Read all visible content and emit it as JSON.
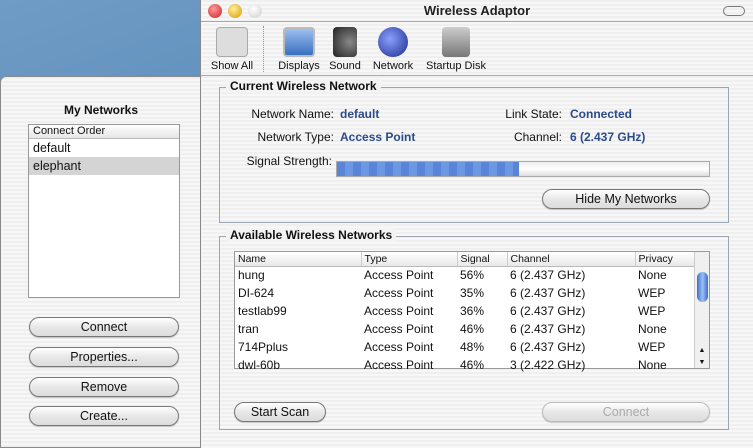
{
  "window": {
    "title": "Wireless Adaptor"
  },
  "toolbar": {
    "items": [
      {
        "label": "Show All",
        "icon": "show-all-icon"
      },
      {
        "label": "Displays",
        "icon": "displays-icon"
      },
      {
        "label": "Sound",
        "icon": "sound-icon"
      },
      {
        "label": "Network",
        "icon": "network-icon"
      },
      {
        "label": "Startup Disk",
        "icon": "startup-disk-icon"
      }
    ]
  },
  "drawer": {
    "title": "My Networks",
    "column": "Connect Order",
    "items": [
      "default",
      "elephant"
    ],
    "selected": 1,
    "buttons": {
      "connect": "Connect",
      "properties": "Properties...",
      "remove": "Remove",
      "create": "Create..."
    }
  },
  "current": {
    "legend": "Current Wireless Network",
    "name_label": "Network Name:",
    "name": "default",
    "type_label": "Network Type:",
    "type": "Access Point",
    "link_label": "Link State:",
    "link": "Connected",
    "channel_label": "Channel:",
    "channel": "6 (2.437 GHz)",
    "signal_label": "Signal Strength:",
    "signal_percent": 49,
    "hide_button": "Hide My Networks"
  },
  "available": {
    "legend": "Available Wireless Networks",
    "columns": [
      "Name",
      "Type",
      "Signal",
      "Channel",
      "Privacy"
    ],
    "rows": [
      [
        "hung",
        "Access Point",
        "56%",
        "6 (2.437 GHz)",
        "None"
      ],
      [
        "DI-624",
        "Access Point",
        "35%",
        "6 (2.437 GHz)",
        "WEP"
      ],
      [
        "testlab99",
        "Access Point",
        "36%",
        "6 (2.437 GHz)",
        "WEP"
      ],
      [
        "tran",
        "Access Point",
        "46%",
        "6 (2.437 GHz)",
        "None"
      ],
      [
        "714Pplus",
        "Access Point",
        "48%",
        "6 (2.437 GHz)",
        "WEP"
      ],
      [
        "dwl-60b",
        "Access Point",
        "46%",
        "3 (2.422 GHz)",
        "None"
      ]
    ],
    "scan_button": "Start Scan",
    "connect_button": "Connect"
  }
}
